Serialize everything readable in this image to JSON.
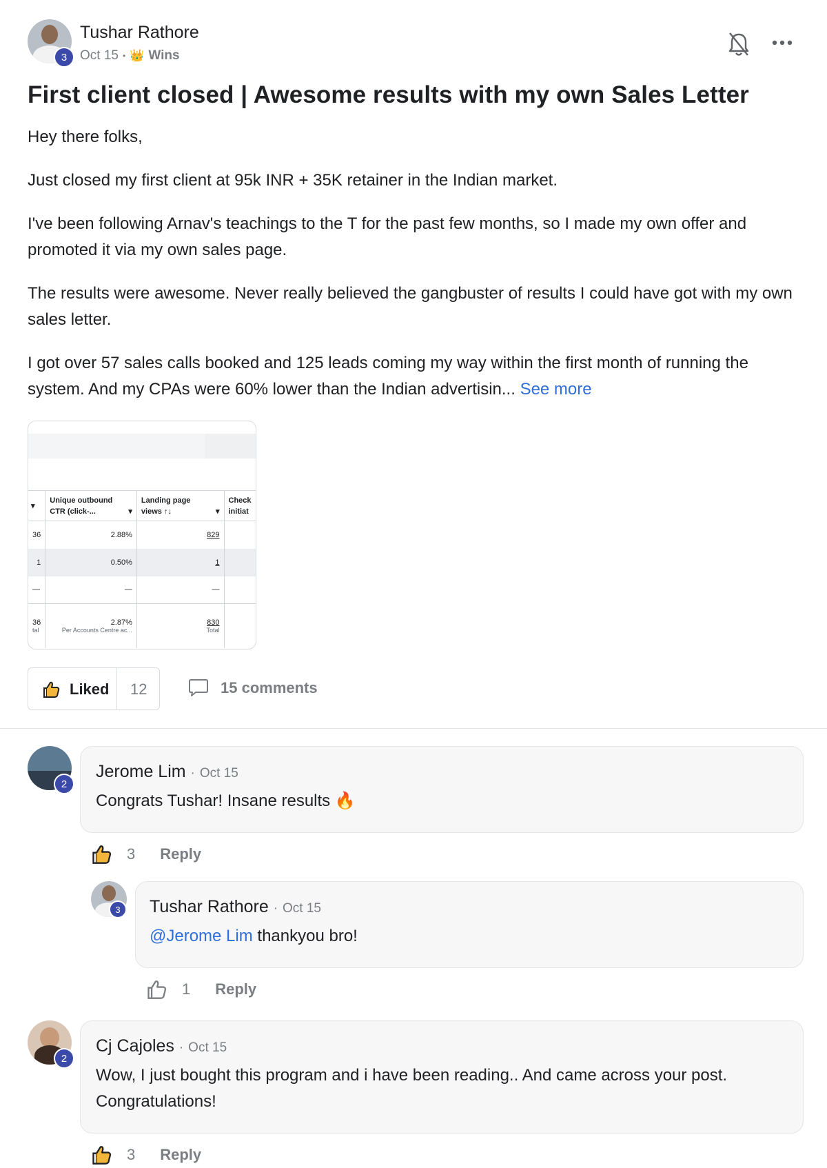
{
  "post": {
    "author": "Tushar Rathore",
    "author_level": "3",
    "date": "Oct 15",
    "meta_sep": "•",
    "category_icon": "crown-emoji",
    "category": "Wins",
    "title": "First client closed | Awesome results with my own Sales Letter",
    "paragraphs": [
      "Hey there folks,",
      "Just closed my first client at 95k INR + 35K retainer in the Indian market.",
      "I've been following Arnav's teachings to the T for the past few months, so I made my own offer and promoted it via my own sales page.",
      "The results were awesome. Never really believed the gangbuster of results I could have got with my own sales letter.",
      "I got over 57 sales calls booked and 125 leads coming my way within the first month of running the system. And my CPAs were 60% lower than the Indian advertisin..."
    ],
    "see_more": "See more",
    "liked_label": "Liked",
    "like_count": "12",
    "comments_label": "15 comments"
  },
  "attachment": {
    "headers": [
      "▾",
      "Unique outbound CTR (click-...",
      "▾",
      "Landing page views ↑↓",
      "▾",
      "Check initiat"
    ],
    "col1_header": "Unique outbound\nCTR (click-...",
    "col2_header": "Landing page\nviews ↑↓",
    "col3_header": "Check\ninitiat",
    "rows": [
      {
        "a": "36",
        "b": "2.88%",
        "c": "829"
      },
      {
        "a": "1",
        "b": "0.50%",
        "c": "1"
      },
      {
        "a": "—",
        "b": "—",
        "c": "—"
      }
    ],
    "total": {
      "a": "36",
      "a_sub": "tal",
      "b": "2.87%",
      "b_sub": "Per Accounts Centre ac...",
      "c": "830",
      "c_sub": "Total"
    }
  },
  "comments": [
    {
      "name": "Jerome Lim",
      "level": "2",
      "date": "Oct 15",
      "text": "Congrats Tushar! Insane results 🔥",
      "likes": "3",
      "reply_label": "Reply"
    },
    {
      "name": "Tushar Rathore",
      "level": "3",
      "date": "Oct 15",
      "mention": "@Jerome Lim",
      "text": " thankyou bro!",
      "likes": "1",
      "reply_label": "Reply"
    },
    {
      "name": "Cj Cajoles",
      "level": "2",
      "date": "Oct 15",
      "text": "Wow, I just bought this program and i have been reading.. And came across your post. Congratulations!",
      "likes": "3",
      "reply_label": "Reply"
    }
  ],
  "date_sep": "·",
  "colors": {
    "accent": "#2f6fdb",
    "badge": "#3b4aa8",
    "muted": "#7a7d82"
  }
}
